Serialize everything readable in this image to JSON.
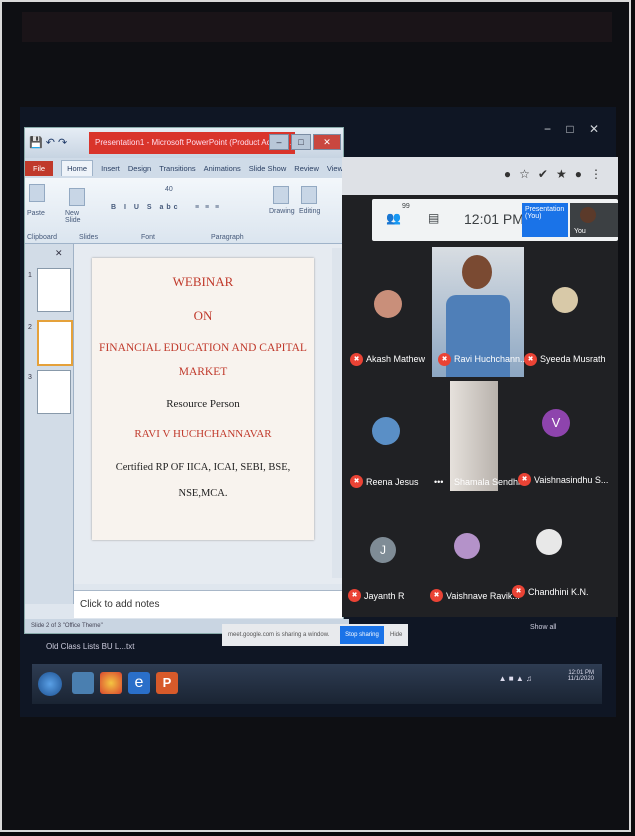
{
  "ppt": {
    "title": "Presentation1 - Microsoft PowerPoint (Product Activat...",
    "tabs": [
      "File",
      "Home",
      "Insert",
      "Design",
      "Transitions",
      "Animations",
      "Slide Show",
      "Review",
      "View"
    ],
    "groups": [
      "Clipboard",
      "Slides",
      "Font",
      "Paragraph",
      "Drawing",
      "Editing"
    ],
    "paste_label": "Paste",
    "new_slide_label": "New Slide",
    "font_size": "40",
    "slide_numbers": [
      "1",
      "2",
      "3"
    ],
    "slide": {
      "line1": "WEBINAR",
      "line2": "ON",
      "line3": "FINANCIAL EDUCATION AND CAPITAL",
      "line4": "MARKET",
      "line5": "Resource Person",
      "line6": "RAVI V HUCHCHANNAVAR",
      "line7": "Certified RP OF IICA, ICAI, SEBI, BSE,",
      "line8": "NSE,MCA."
    },
    "notes_placeholder": "Click to add notes",
    "status": "Slide 2 of 3   \"Office Theme\""
  },
  "meet": {
    "participants_count": "99",
    "time": "12:01 PM",
    "presentation_label": "Presentation (You)",
    "you_label": "You",
    "sharing_text": "meet.google.com is sharing a window.",
    "stop_sharing": "Stop sharing",
    "hide": "Hide",
    "show_all": "Show all",
    "participants": [
      "Akash Mathew",
      "Ravi Huchchann...",
      "Syeeda Musrath",
      "Reena Jesus",
      "Shamala Sendhil",
      "Vaishnasindhu S...",
      "Jayanth R",
      "Vaishnave Ravik...",
      "Chandhini K.N."
    ],
    "avatar_letters": {
      "vaishnasindhu": "V",
      "jayanth": "J"
    }
  },
  "taskbar": {
    "download_item": "Old Class Lists BU L...txt",
    "clock_time": "12:01 PM",
    "clock_date": "11/1/2020"
  }
}
